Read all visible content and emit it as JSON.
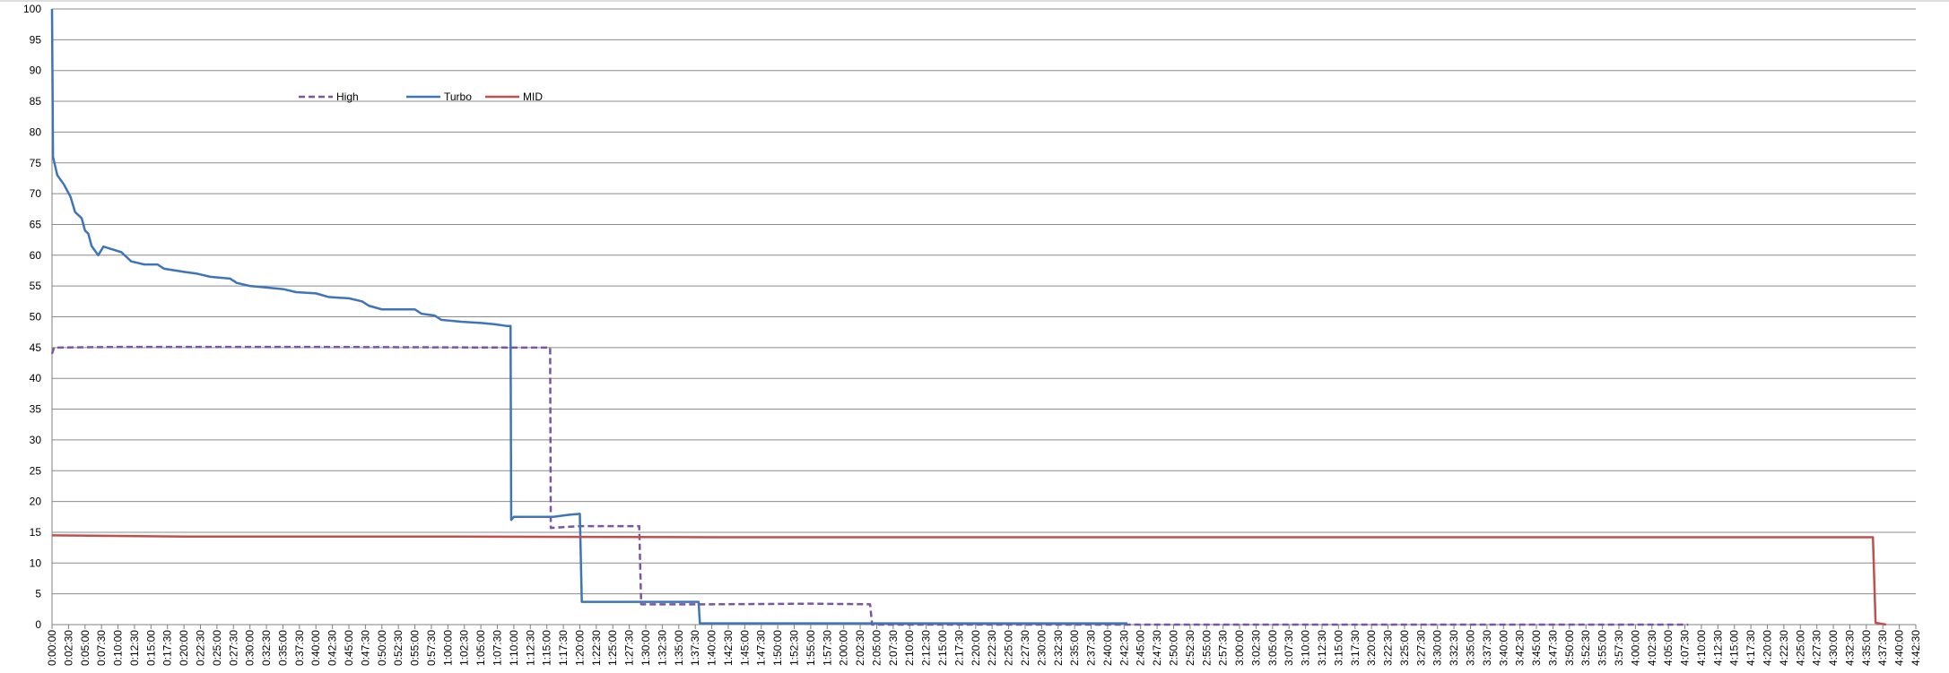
{
  "chart_data": {
    "type": "line",
    "title": "",
    "xlabel": "",
    "ylabel": "",
    "ylim": [
      0,
      100
    ],
    "y_ticks": [
      0,
      5,
      10,
      15,
      20,
      25,
      30,
      35,
      40,
      45,
      50,
      55,
      60,
      65,
      70,
      75,
      80,
      85,
      90,
      95,
      100
    ],
    "x_range_minutes": [
      0,
      282.5
    ],
    "x_tick_step_minutes": 2.5,
    "grid": "horizontal",
    "legend_position": "upper-left",
    "series": [
      {
        "name": "High",
        "color": "#7a56a0",
        "style": "dashed",
        "points": [
          [
            0,
            44
          ],
          [
            0.3,
            45
          ],
          [
            10,
            45.1
          ],
          [
            40,
            45.1
          ],
          [
            70,
            45
          ],
          [
            75,
            45
          ],
          [
            75.5,
            45
          ],
          [
            75.6,
            15.7
          ],
          [
            80,
            16
          ],
          [
            89,
            16
          ],
          [
            89.3,
            3.3
          ],
          [
            100,
            3.3
          ],
          [
            115,
            3.4
          ],
          [
            124,
            3.3
          ],
          [
            124.3,
            0
          ],
          [
            200,
            0
          ],
          [
            248,
            0
          ]
        ]
      },
      {
        "name": "Turbo",
        "color": "#3f74b8",
        "style": "solid",
        "points": [
          [
            0,
            100
          ],
          [
            0.15,
            76
          ],
          [
            0.8,
            73
          ],
          [
            1.8,
            71.5
          ],
          [
            2.8,
            69.5
          ],
          [
            3.5,
            67
          ],
          [
            4.5,
            66
          ],
          [
            5,
            64
          ],
          [
            5.5,
            63.5
          ],
          [
            6,
            61.5
          ],
          [
            7,
            60
          ],
          [
            7.8,
            61.4
          ],
          [
            9,
            61
          ],
          [
            10.5,
            60.5
          ],
          [
            12,
            59
          ],
          [
            14,
            58.5
          ],
          [
            16,
            58.5
          ],
          [
            17,
            57.8
          ],
          [
            20,
            57.3
          ],
          [
            22,
            57
          ],
          [
            24,
            56.5
          ],
          [
            27,
            56.2
          ],
          [
            28,
            55.5
          ],
          [
            30,
            55
          ],
          [
            32,
            54.8
          ],
          [
            35,
            54.5
          ],
          [
            37,
            54
          ],
          [
            40,
            53.8
          ],
          [
            42,
            53.2
          ],
          [
            45,
            53
          ],
          [
            47,
            52.5
          ],
          [
            48,
            51.8
          ],
          [
            50,
            51.2
          ],
          [
            55,
            51.2
          ],
          [
            56,
            50.5
          ],
          [
            58,
            50.2
          ],
          [
            59,
            49.5
          ],
          [
            62,
            49.2
          ],
          [
            65,
            49
          ],
          [
            67,
            48.8
          ],
          [
            69,
            48.5
          ],
          [
            69.5,
            48.5
          ],
          [
            69.6,
            17
          ],
          [
            70,
            17.5
          ],
          [
            73,
            17.5
          ],
          [
            76,
            17.5
          ],
          [
            78,
            17.8
          ],
          [
            80,
            18
          ],
          [
            80.3,
            3.7
          ],
          [
            90,
            3.7
          ],
          [
            98,
            3.7
          ],
          [
            98.2,
            0.2
          ],
          [
            120,
            0.2
          ],
          [
            160,
            0.2
          ],
          [
            163,
            0.2
          ]
        ]
      },
      {
        "name": "MID",
        "color": "#c0504d",
        "style": "solid",
        "points": [
          [
            0,
            14.5
          ],
          [
            20,
            14.3
          ],
          [
            60,
            14.3
          ],
          [
            100,
            14.2
          ],
          [
            150,
            14.2
          ],
          [
            200,
            14.2
          ],
          [
            250,
            14.2
          ],
          [
            276,
            14.2
          ],
          [
            276.4,
            0.3
          ],
          [
            278,
            0
          ]
        ]
      }
    ],
    "x_tick_labels": [
      "0:00:00",
      "0:02:30",
      "0:05:00",
      "0:07:30",
      "0:10:00",
      "0:12:30",
      "0:15:00",
      "0:17:30",
      "0:20:00",
      "0:22:30",
      "0:25:00",
      "0:27:30",
      "0:30:00",
      "0:32:30",
      "0:35:00",
      "0:37:30",
      "0:40:00",
      "0:42:30",
      "0:45:00",
      "0:47:30",
      "0:50:00",
      "0:52:30",
      "0:55:00",
      "0:57:30",
      "1:00:00",
      "1:02:30",
      "1:05:00",
      "1:07:30",
      "1:10:00",
      "1:12:30",
      "1:15:00",
      "1:17:30",
      "1:20:00",
      "1:22:30",
      "1:25:00",
      "1:27:30",
      "1:30:00",
      "1:32:30",
      "1:35:00",
      "1:37:30",
      "1:40:00",
      "1:42:30",
      "1:45:00",
      "1:47:30",
      "1:50:00",
      "1:52:30",
      "1:55:00",
      "1:57:30",
      "2:00:00",
      "2:02:30",
      "2:05:00",
      "2:07:30",
      "2:10:00",
      "2:12:30",
      "2:15:00",
      "2:17:30",
      "2:20:00",
      "2:22:30",
      "2:25:00",
      "2:27:30",
      "2:30:00",
      "2:32:30",
      "2:35:00",
      "2:37:30",
      "2:40:00",
      "2:42:30",
      "2:45:00",
      "2:47:30",
      "2:50:00",
      "2:52:30",
      "2:55:00",
      "2:57:30",
      "3:00:00",
      "3:02:30",
      "3:05:00",
      "3:07:30",
      "3:10:00",
      "3:12:30",
      "3:15:00",
      "3:17:30",
      "3:20:00",
      "3:22:30",
      "3:25:00",
      "3:27:30",
      "3:30:00",
      "3:32:30",
      "3:35:00",
      "3:37:30",
      "3:40:00",
      "3:42:30",
      "3:45:00",
      "3:47:30",
      "3:50:00",
      "3:52:30",
      "3:55:00",
      "3:57:30",
      "4:00:00",
      "4:02:30",
      "4:05:00",
      "4:07:30",
      "4:10:00",
      "4:12:30",
      "4:15:00",
      "4:17:30",
      "4:20:00",
      "4:22:30",
      "4:25:00",
      "4:27:30",
      "4:30:00",
      "4:32:30",
      "4:35:00",
      "4:37:30",
      "4:40:00",
      "4:42:30"
    ]
  }
}
